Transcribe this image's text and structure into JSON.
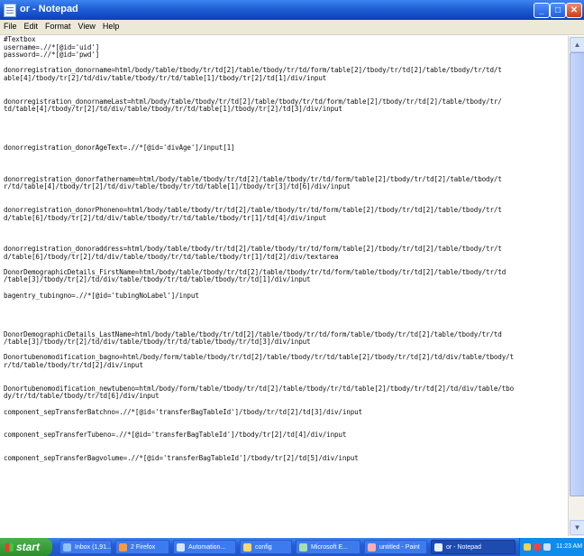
{
  "window": {
    "title": "or - Notepad",
    "buttons": [
      "_",
      "□",
      "✕"
    ]
  },
  "menu": [
    "File",
    "Edit",
    "Format",
    "View",
    "Help"
  ],
  "editor_lines": [
    "#Textbox",
    "username=.//*[@id='uid']",
    "password=.//*[@id='pwd']",
    "",
    "donorregistration_donorname=html/body/table/tbody/tr/td[2]/table/tbody/tr/td/form/table[2]/tbody/tr/td[2]/table/tbody/tr/td/t",
    "able[4]/tbody/tr[2]/td/div/table/tbody/tr/td/table[1]/tbody/tr[2]/td[1]/div/input",
    "",
    "",
    "donorregistration_donornameLast=html/body/table/tbody/tr/td[2]/table/tbody/tr/td/form/table[2]/tbody/tr/td[2]/table/tbody/tr/",
    "td/table[4]/tbody/tr[2]/td/div/table/tbody/tr/td/table[1]/tbody/tr[2]/td[3]/div/input",
    "",
    "",
    "",
    "",
    "donorregistration_donorAgeText=.//*[@id='divAge']/input[1]",
    "",
    "",
    "",
    "donorregistration_donorfathername=html/body/table/tbody/tr/td[2]/table/tbody/tr/td/form/table[2]/tbody/tr/td[2]/table/tbody/t",
    "r/td/table[4]/tbody/tr[2]/td/div/table/tbody/tr/td/table[1]/tbody/tr[3]/td[6]/div/input",
    "",
    "",
    "donorregistration_donorPhoneno=html/body/table/tbody/tr/td[2]/table/tbody/tr/td/form/table[2]/tbody/tr/td[2]/table/tbody/tr/t",
    "d/table[6]/tbody/tr[2]/td/div/table/tbody/tr/td/table/tbody/tr[1]/td[4]/div/input",
    "",
    "",
    "",
    "donorregistration_donoraddress=html/body/table/tbody/tr/td[2]/table/tbody/tr/td/form/table[2]/tbody/tr/td[2]/table/tbody/tr/t",
    "d/table[6]/tbody/tr[2]/td/div/table/tbody/tr/td/table/tbody/tr[1]/td[2]/div/textarea",
    "",
    "DonorDemographicDetails_FirstName=html/body/table/tbody/tr/td[2]/table/tbody/tr/td/form/table/tbody/tr/td[2]/table/tbody/tr/td",
    "/table[3]/tbody/tr[2]/td/div/table/tbody/tr/td/table/tbody/tr/td[1]/div/input",
    "",
    "bagentry_tubingno=.//*[@id='tubingNoLabel']/input",
    "",
    "",
    "",
    "",
    "DonorDemographicDetails_LastName=html/body/table/tbody/tr/td[2]/table/tbody/tr/td/form/table/tbody/tr/td[2]/table/tbody/tr/td",
    "/table[3]/tbody/tr[2]/td/div/table/tbody/tr/td/table/tbody/tr/td[3]/div/input",
    "",
    "Donortubenomodification_bagno=html/body/form/table/tbody/tr/td[2]/table/tbody/tr/td/table[2]/tbody/tr/td[2]/td/div/table/tbody/t",
    "r/td/table/tbody/tr/td[2]/div/input",
    "",
    "",
    "Donortubenomodification_newtubeno=html/body/form/table/tbody/tr/td[2]/table/tbody/tr/td/table[2]/tbody/tr/td[2]/td/div/table/tbo",
    "dy/tr/td/table/tbody/tr/td[6]/div/input",
    "",
    "component_sepTransferBatchno=.//*[@id='transferBagTableId']/tbody/tr/td[2]/td[3]/div/input",
    "",
    "",
    "component_sepTransferTubeno=.//*[@id='transferBagTableId']/tbody/tr[2]/td[4]/div/input",
    "",
    "",
    "component_sepTransferBagvolume=.//*[@id='transferBagTableId']/tbody/tr[2]/td[5]/div/input"
  ],
  "taskbar": {
    "start_label": "start",
    "items": [
      "Inbox (1,91...",
      "2 Firefox",
      "Automation...",
      "config",
      "Microsoft E...",
      "untitled - Paint",
      "or - Notepad"
    ],
    "active_item": "or - Notepad",
    "clock": "11:23 AM"
  }
}
